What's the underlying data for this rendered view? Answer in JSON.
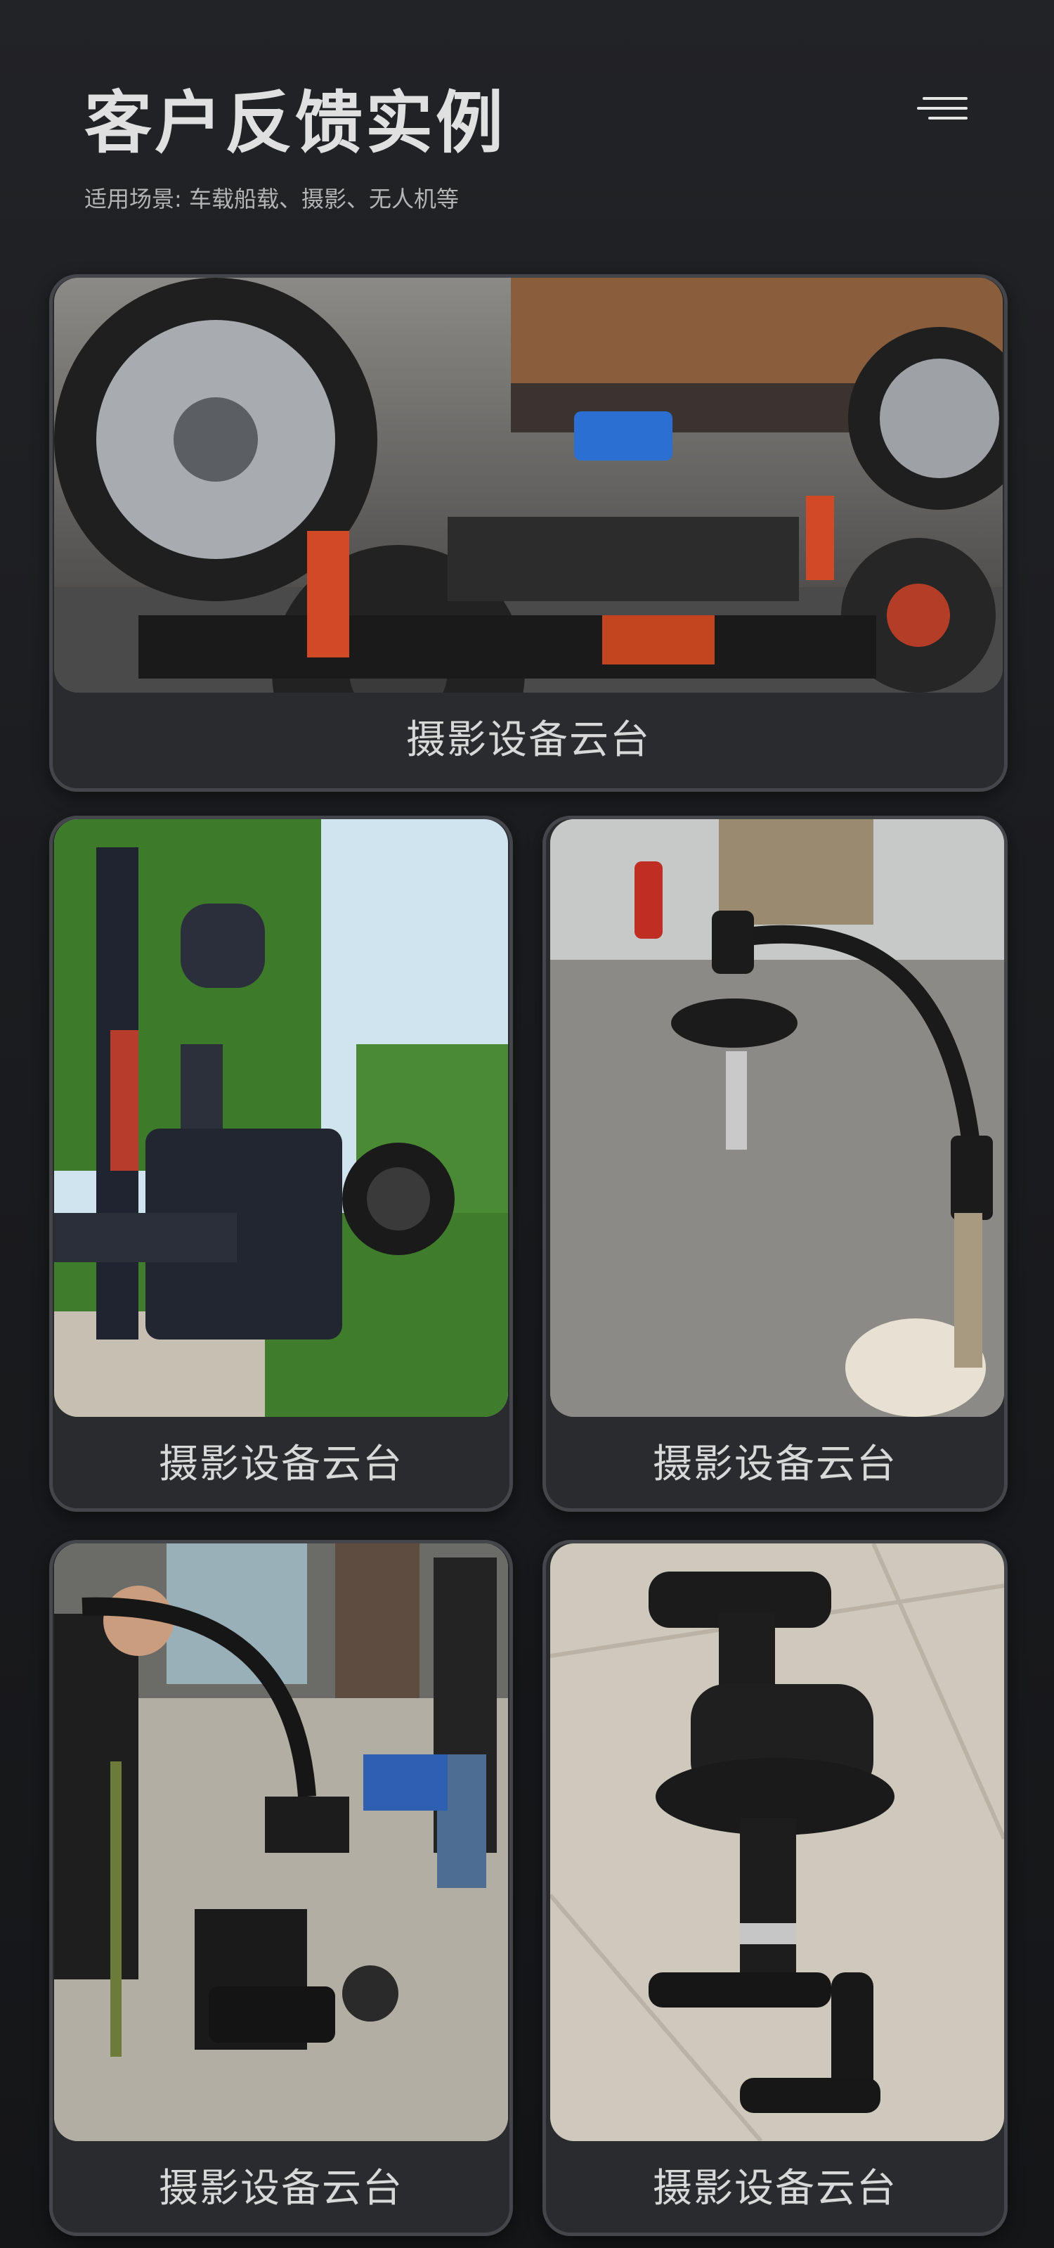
{
  "header": {
    "title": "客户反馈实例",
    "subtitle": "适用场景: 车载船载、摄影、无人机等"
  },
  "menu": {
    "icon": "hamburger-menu-icon"
  },
  "cards": [
    {
      "caption": "摄影设备云台",
      "image": "car-mounted-gimbal-rig"
    },
    {
      "caption": "摄影设备云台",
      "image": "ronin-camera-gimbal-outdoor"
    },
    {
      "caption": "摄影设备云台",
      "image": "curved-arm-gimbal-warehouse"
    },
    {
      "caption": "摄影设备云台",
      "image": "crew-operating-crane-gimbal"
    },
    {
      "caption": "摄影设备云台",
      "image": "black-gimbal-mount-on-tile-floor"
    }
  ],
  "colors": {
    "background": "#1b1c1f",
    "card": "#2a2b2e",
    "card_border": "#44464b",
    "text": "#d8d8d8"
  }
}
